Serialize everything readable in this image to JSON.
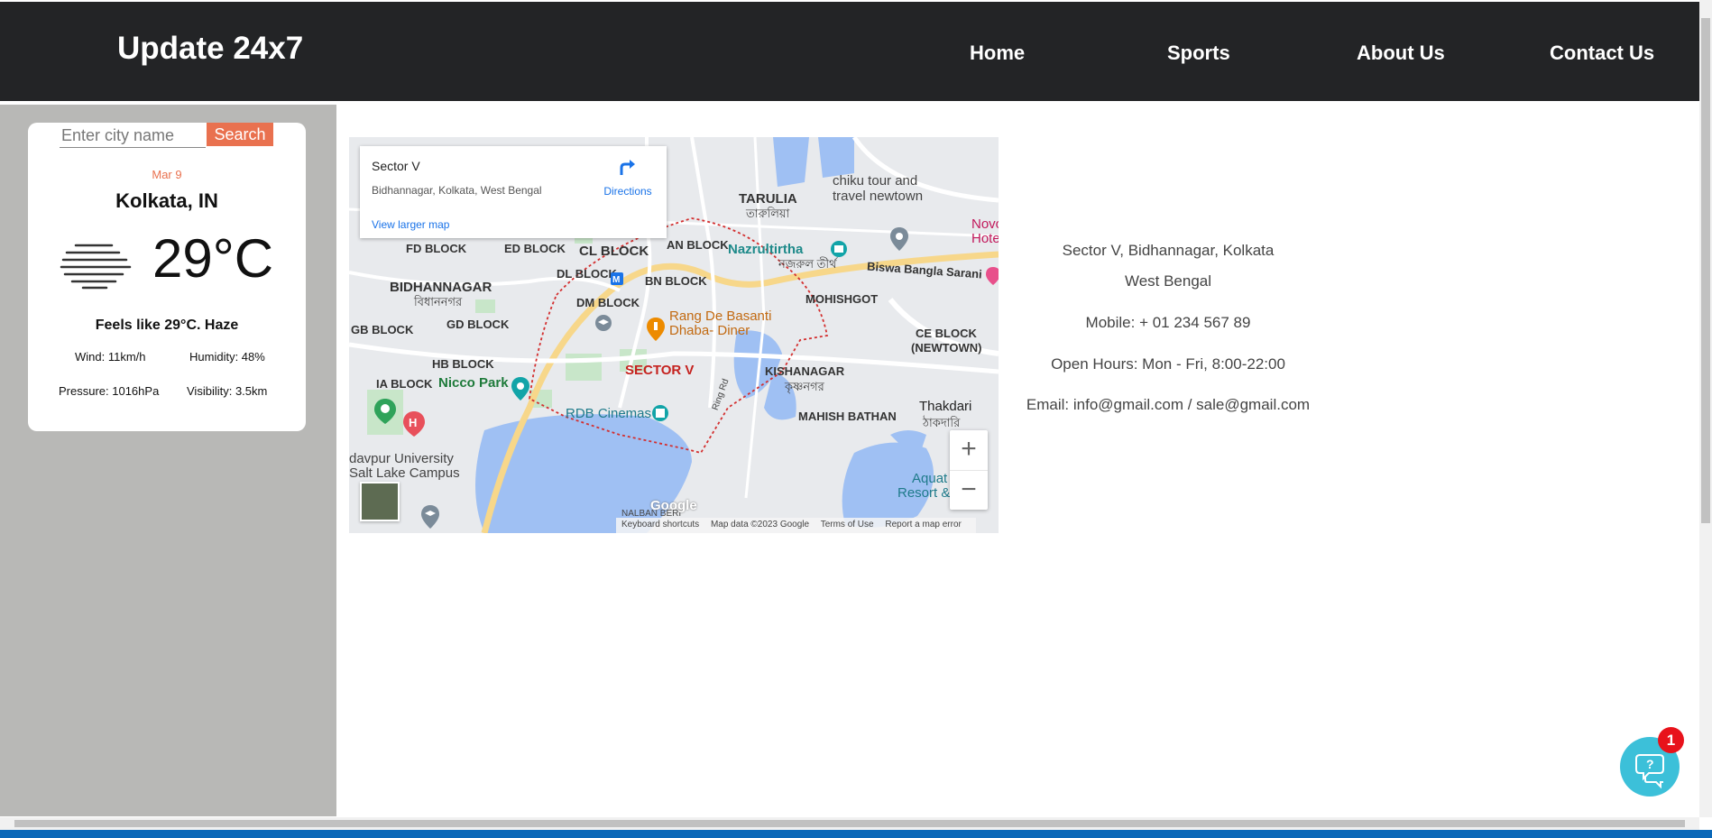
{
  "navbar": {
    "brand": "Update 24x7",
    "links": [
      "Home",
      "Sports",
      "About Us",
      "Contact Us"
    ]
  },
  "weather": {
    "search_placeholder": "Enter city name",
    "search_label": "Search",
    "date": "Mar 9",
    "city": "Kolkata, IN",
    "temp": "29°C",
    "icon": "haze-icon",
    "feels": "Feels like 29°C. Haze",
    "wind": "Wind: 11km/h",
    "humidity": "Humidity: 48%",
    "pressure": "Pressure: 1016hPa",
    "visibility": "Visibility: 3.5km"
  },
  "map": {
    "place_title": "Sector V",
    "place_address": "Bidhannagar, Kolkata, West Bengal",
    "directions": "Directions",
    "view_larger": "View larger map",
    "labels": {
      "tarulia": "TARULIA",
      "tarulia_bn": "তারুলিয়া",
      "chiku": "chiku tour and",
      "chiku2": "travel newtown",
      "fd_block": "FD BLOCK",
      "ed_block": "ED BLOCK",
      "cl_block": "CL BLOCK",
      "dl_block": "DL BLOCK",
      "an_block": "AN BLOCK",
      "bidhannagar": "BIDHANNAGAR",
      "bidhannagar_bn": "বিধাননগর",
      "bn_block": "BN BLOCK",
      "dm_block": "DM BLOCK",
      "nazrultirtha": "Nazrultirtha",
      "nazrultirtha_bn": "নজরুল তীর্থ",
      "biswa_bangla": "Biswa Bangla Sarani",
      "mohishgot": "MOHISHGOT",
      "gd_block": "GD BLOCK",
      "gb_block": "GB BLOCK",
      "rang_de": "Rang De Basanti",
      "rang_de2": "Dhaba- Diner",
      "ce_block": "CE BLOCK",
      "newtown": "(NEWTOWN)",
      "hb_block": "HB BLOCK",
      "sector_v": "SECTOR V",
      "kishanagar": "KISHANAGAR",
      "kishanagar_bn": "কৃষ্ণনগর",
      "ia_block": "IA BLOCK",
      "nicco": "Nicco Park",
      "rdb": "RDB Cinemas",
      "mahish": "MAHISH BATHAN",
      "thakdari": "Thakdari",
      "thakdari_bn": "ঠাকদারি",
      "jadavpur": "davpur University",
      "saltlake": "Salt Lake Campus",
      "aquat": "Aquat",
      "resort": "Resort &",
      "nalban": "NALBAN BERI",
      "ring_rd": "Ring Rd",
      "novo": "Novo",
      "hote": "Hote"
    },
    "google": "Google",
    "footer": [
      "Keyboard shortcuts",
      "Map data ©2023 Google",
      "Terms of Use",
      "Report a map error"
    ]
  },
  "contact": {
    "address1": "Sector V, Bidhannagar, Kolkata",
    "address2": "West Bengal",
    "mobile": "Mobile: + 01 234 567 89",
    "hours": "Open Hours: Mon - Fri, 8:00-22:00",
    "email": "Email: info@gmail.com / sale@gmail.com"
  },
  "chat": {
    "badge": "1",
    "icon": "chat-bubble-icon"
  },
  "colors": {
    "navbar": "#232426",
    "accent": "#e9714f",
    "sidebar": "#b8b8b6",
    "chat": "#3cc0d9",
    "badge": "#e8121b"
  }
}
